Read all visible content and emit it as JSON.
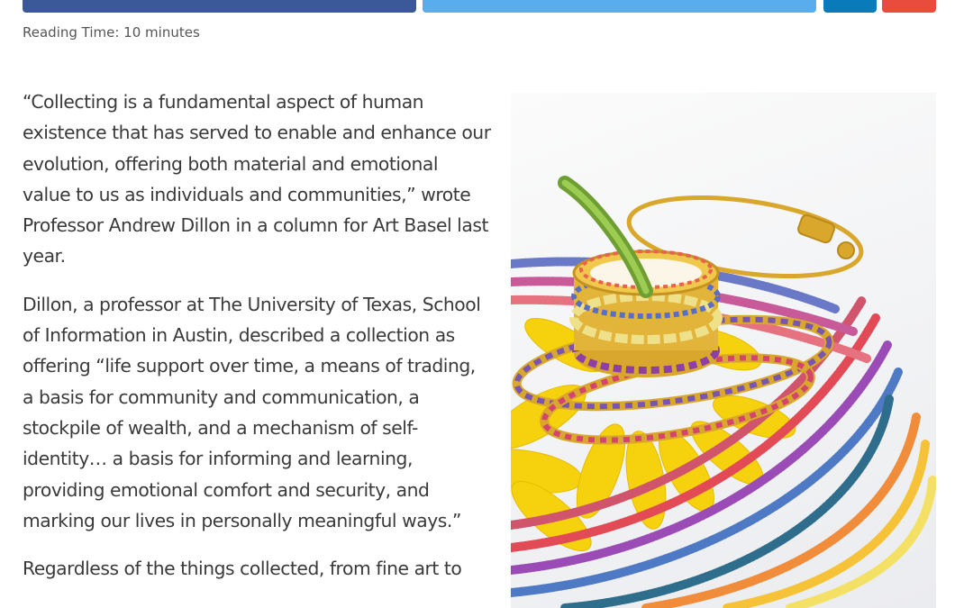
{
  "reading_time": "Reading Time: 10 minutes",
  "share_buttons": [
    "facebook-share",
    "twitter-share",
    "linkedin-share",
    "email-share"
  ],
  "colors": {
    "facebook": "#3b5998",
    "twitter": "#5aadec",
    "linkedin": "#0a7bba",
    "email": "#e94c3d"
  },
  "article": {
    "paragraphs": [
      "“Collecting is a fundamental aspect of human existence that has served to enable and enhance our evolution, offering both material and emotional value to us as individuals and communities,” wrote Professor Andrew Dillon in a column for Art Basel last year.",
      "Dillon, a professor at The University of Texas, School of Information in Austin, described a collection as offering “life support over time, a means of trading, a basis for community and communication, a stockpile of wealth, and a mechanism of self-identity… a basis for informing and learning, providing emotional comfort and security, and marking our lives in personally meaningful ways.”",
      "Regardless of the things collected, from fine art to"
    ]
  },
  "image": {
    "subject": "rainbow gemstone rings, tennis bracelets and beaded necklaces on a yellow flower"
  }
}
